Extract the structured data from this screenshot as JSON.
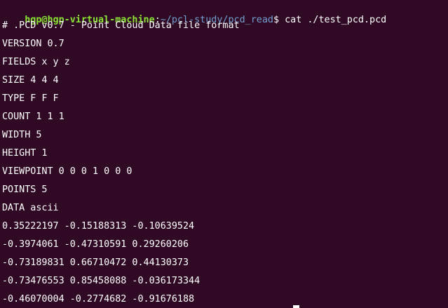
{
  "prompt": {
    "user_host": "hgp@hgp-virtual-machine",
    "colon": ":",
    "path": "~/pcl-study/pcd_read",
    "dollar": "$",
    "command": " cat ./test_pcd.pcd"
  },
  "output_lines": [
    "# .PCD v0.7 - Point Cloud Data file format",
    "VERSION 0.7",
    "FIELDS x y z",
    "SIZE 4 4 4",
    "TYPE F F F",
    "COUNT 1 1 1",
    "WIDTH 5",
    "HEIGHT 1",
    "VIEWPOINT 0 0 0 1 0 0 0",
    "POINTS 5",
    "DATA ascii",
    "0.35222197 -0.15188313 -0.10639524",
    "-0.3974061 -0.47310591 0.29260206",
    "-0.73189831 0.66710472 0.44130373",
    "-0.73476553 0.85458088 -0.036173344",
    "-0.46070004 -0.2774682 -0.91676188"
  ],
  "colors": {
    "background": "#300a24",
    "user_host": "#8ae234",
    "path": "#729fcf",
    "text": "#ffffff"
  }
}
